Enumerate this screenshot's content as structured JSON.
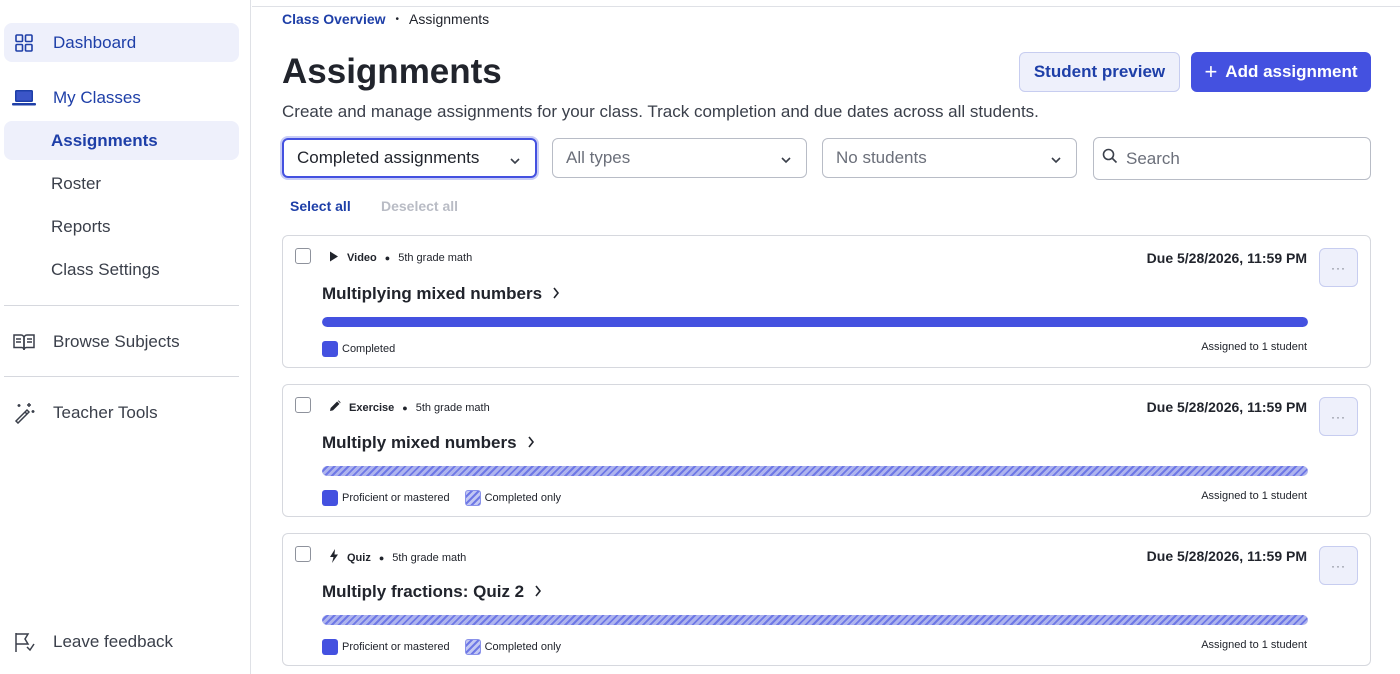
{
  "sidebar": {
    "dashboard": "Dashboard",
    "my_classes": "My Classes",
    "sub_items": [
      "Assignments",
      "Roster",
      "Reports",
      "Class Settings"
    ],
    "browse_subjects": "Browse Subjects",
    "teacher_tools": "Teacher Tools",
    "leave_feedback": "Leave feedback"
  },
  "breadcrumb": {
    "parent": "Class Overview",
    "separator": "•",
    "current": "Assignments"
  },
  "header": {
    "title": "Assignments",
    "subtitle": "Create and manage assignments for your class. Track completion and due dates across all students.",
    "student_preview": "Student preview",
    "add_assignment": "Add assignment"
  },
  "filters": {
    "status": "Completed assignments",
    "type": "All types",
    "students": "No students",
    "search_placeholder": "Search"
  },
  "selection": {
    "select_all": "Select all",
    "deselect_all": "Deselect all"
  },
  "assignments": [
    {
      "type": "Video",
      "type_icon": "play-icon",
      "course": "5th grade math",
      "due": "Due 5/28/2026, 11:59 PM",
      "title": "Multiplying mixed numbers",
      "progress": 1.0,
      "progress_style": "solid",
      "legend": [
        "Completed"
      ],
      "assigned": "Assigned to 1 student"
    },
    {
      "type": "Exercise",
      "type_icon": "pencil-icon",
      "course": "5th grade math",
      "due": "Due 5/28/2026, 11:59 PM",
      "title": "Multiply mixed numbers",
      "progress": 1.0,
      "progress_style": "hatch",
      "legend": [
        "Proficient or mastered",
        "Completed only"
      ],
      "assigned": "Assigned to 1 student"
    },
    {
      "type": "Quiz",
      "type_icon": "lightning-icon",
      "course": "5th grade math",
      "due": "Due 5/28/2026, 11:59 PM",
      "title": "Multiply fractions: Quiz 2",
      "progress": 1.0,
      "progress_style": "hatch",
      "legend": [
        "Proficient or mastered",
        "Completed only"
      ],
      "assigned": "Assigned to 1 student"
    }
  ],
  "colors": {
    "accent": "#4451e0",
    "link": "#1e3fa8",
    "active_bg": "#eef0fb"
  }
}
